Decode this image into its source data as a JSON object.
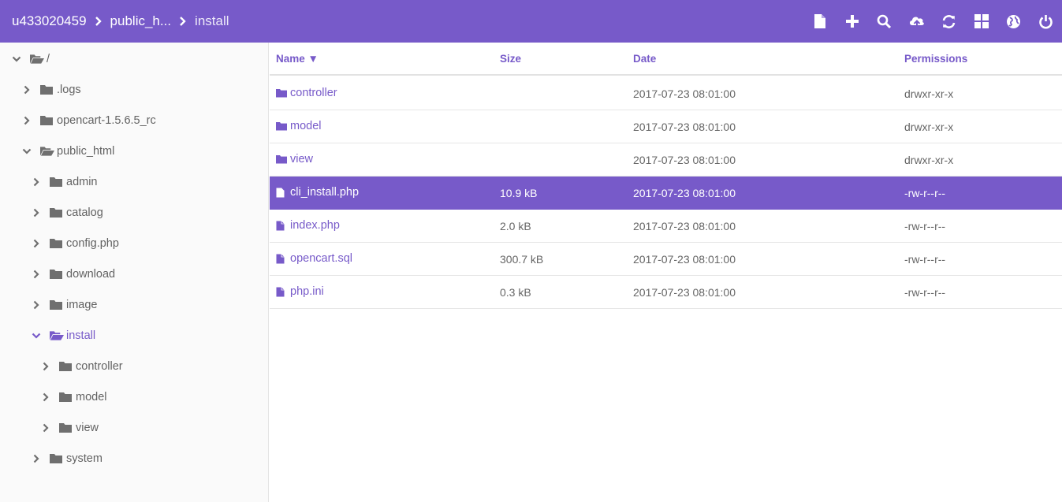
{
  "breadcrumb": {
    "items": [
      "u433020459",
      "public_h...",
      "install"
    ]
  },
  "toolbar": {
    "icons": [
      "new-file-icon",
      "add-icon",
      "search-icon",
      "upload-icon",
      "refresh-icon",
      "grid-view-icon",
      "globe-icon",
      "power-icon"
    ]
  },
  "colors": {
    "accent": "#775ac9",
    "sidebar_bg": "#fafafa",
    "folder_grey": "#6f6f6f"
  },
  "tree": [
    {
      "label": "/",
      "expanded": true
    },
    {
      "label": ".logs",
      "expanded": false
    },
    {
      "label": "opencart-1.5.6.5_rc",
      "expanded": false
    },
    {
      "label": "public_html",
      "expanded": true
    },
    {
      "label": "admin",
      "expanded": false
    },
    {
      "label": "catalog",
      "expanded": false
    },
    {
      "label": "config.php",
      "expanded": false
    },
    {
      "label": "download",
      "expanded": false
    },
    {
      "label": "image",
      "expanded": false
    },
    {
      "label": "install",
      "expanded": true,
      "active": true
    },
    {
      "label": "controller",
      "expanded": false
    },
    {
      "label": "model",
      "expanded": false
    },
    {
      "label": "view",
      "expanded": false
    },
    {
      "label": "system",
      "expanded": false
    }
  ],
  "table": {
    "headers": {
      "name": "Name ▼",
      "size": "Size",
      "date": "Date",
      "permissions": "Permissions"
    },
    "rows": [
      {
        "name": "controller",
        "type": "folder",
        "size": "",
        "date": "2017-07-23 08:01:00",
        "permissions": "drwxr-xr-x"
      },
      {
        "name": "model",
        "type": "folder",
        "size": "",
        "date": "2017-07-23 08:01:00",
        "permissions": "drwxr-xr-x"
      },
      {
        "name": "view",
        "type": "folder",
        "size": "",
        "date": "2017-07-23 08:01:00",
        "permissions": "drwxr-xr-x"
      },
      {
        "name": "cli_install.php",
        "type": "file",
        "size": "10.9 kB",
        "date": "2017-07-23 08:01:00",
        "permissions": "-rw-r--r--",
        "selected": true
      },
      {
        "name": "index.php",
        "type": "file",
        "size": "2.0 kB",
        "date": "2017-07-23 08:01:00",
        "permissions": "-rw-r--r--"
      },
      {
        "name": "opencart.sql",
        "type": "file",
        "size": "300.7 kB",
        "date": "2017-07-23 08:01:00",
        "permissions": "-rw-r--r--"
      },
      {
        "name": "php.ini",
        "type": "file",
        "size": "0.3 kB",
        "date": "2017-07-23 08:01:00",
        "permissions": "-rw-r--r--"
      }
    ]
  }
}
